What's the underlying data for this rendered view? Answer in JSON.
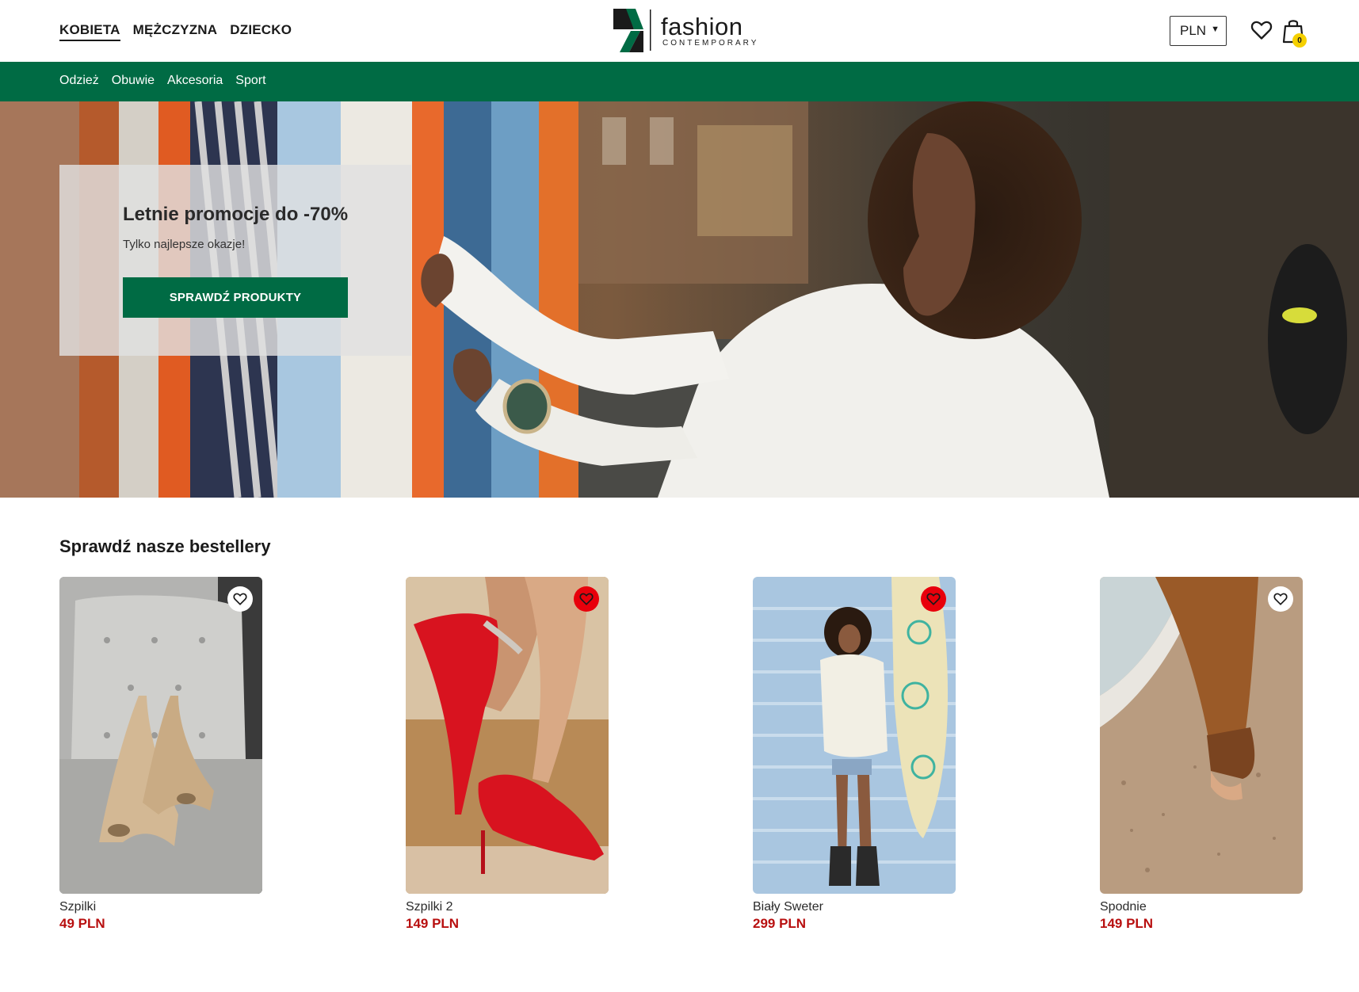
{
  "header": {
    "gender_nav": [
      {
        "label": "KOBIETA",
        "active": true
      },
      {
        "label": "MĘŻCZYZNA",
        "active": false
      },
      {
        "label": "DZIECKO",
        "active": false
      }
    ],
    "logo": {
      "name": "fashion",
      "tagline": "CONTEMPORARY"
    },
    "currency": "PLN",
    "cart_count": "0",
    "icons": {
      "wishlist": "heart-icon",
      "cart": "shopping-bag-icon",
      "currency_caret": "chevron-down-icon"
    }
  },
  "category_nav": [
    "Odzież",
    "Obuwie",
    "Akcesoria",
    "Sport"
  ],
  "hero": {
    "title": "Letnie promocje do -70%",
    "subtitle": "Tylko najlepsze okazje!",
    "cta": "SPRAWDŹ PRODUKTY"
  },
  "bestsellers": {
    "title": "Sprawdź nasze bestellery",
    "products": [
      {
        "name": "Szpilki",
        "price": "49 PLN",
        "favorite": false
      },
      {
        "name": "Szpilki 2",
        "price": "149 PLN",
        "favorite": true
      },
      {
        "name": "Biały Sweter",
        "price": "299 PLN",
        "favorite": true
      },
      {
        "name": "Spodnie",
        "price": "149 PLN",
        "favorite": false
      }
    ]
  },
  "colors": {
    "brand_green": "#006b44",
    "price_red": "#b80f0f",
    "favorite_red": "#e8000b",
    "badge_yellow": "#f5d000"
  }
}
